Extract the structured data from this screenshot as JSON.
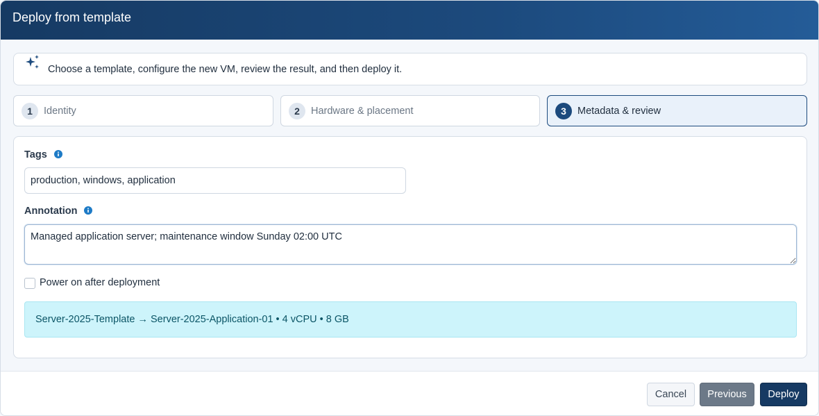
{
  "dialog": {
    "title": "Deploy from template"
  },
  "intro": {
    "icon": "sparkles-icon",
    "text": "Choose a template, configure the new VM, review the result, and then deploy it."
  },
  "steps": [
    {
      "number": "1",
      "label": "Identity",
      "active": false
    },
    {
      "number": "2",
      "label": "Hardware & placement",
      "active": false
    },
    {
      "number": "3",
      "label": "Metadata & review",
      "active": true
    }
  ],
  "form": {
    "tags": {
      "label": "Tags",
      "value": "production, windows, application"
    },
    "annotation": {
      "label": "Annotation",
      "value": "Managed application server; maintenance window Sunday 02:00 UTC"
    },
    "power_on": {
      "label": "Power on after deployment",
      "checked": false
    },
    "summary": "Server-2025-Template → Server-2025-Application-01 • 4 vCPU • 8 GB"
  },
  "footer": {
    "cancel_label": "Cancel",
    "previous_label": "Previous",
    "deploy_label": "Deploy"
  },
  "colors": {
    "header": "#1c4a7d",
    "accent": "#163a63",
    "info": "#1e7bc6",
    "summary_bg": "#cdf4fb"
  }
}
